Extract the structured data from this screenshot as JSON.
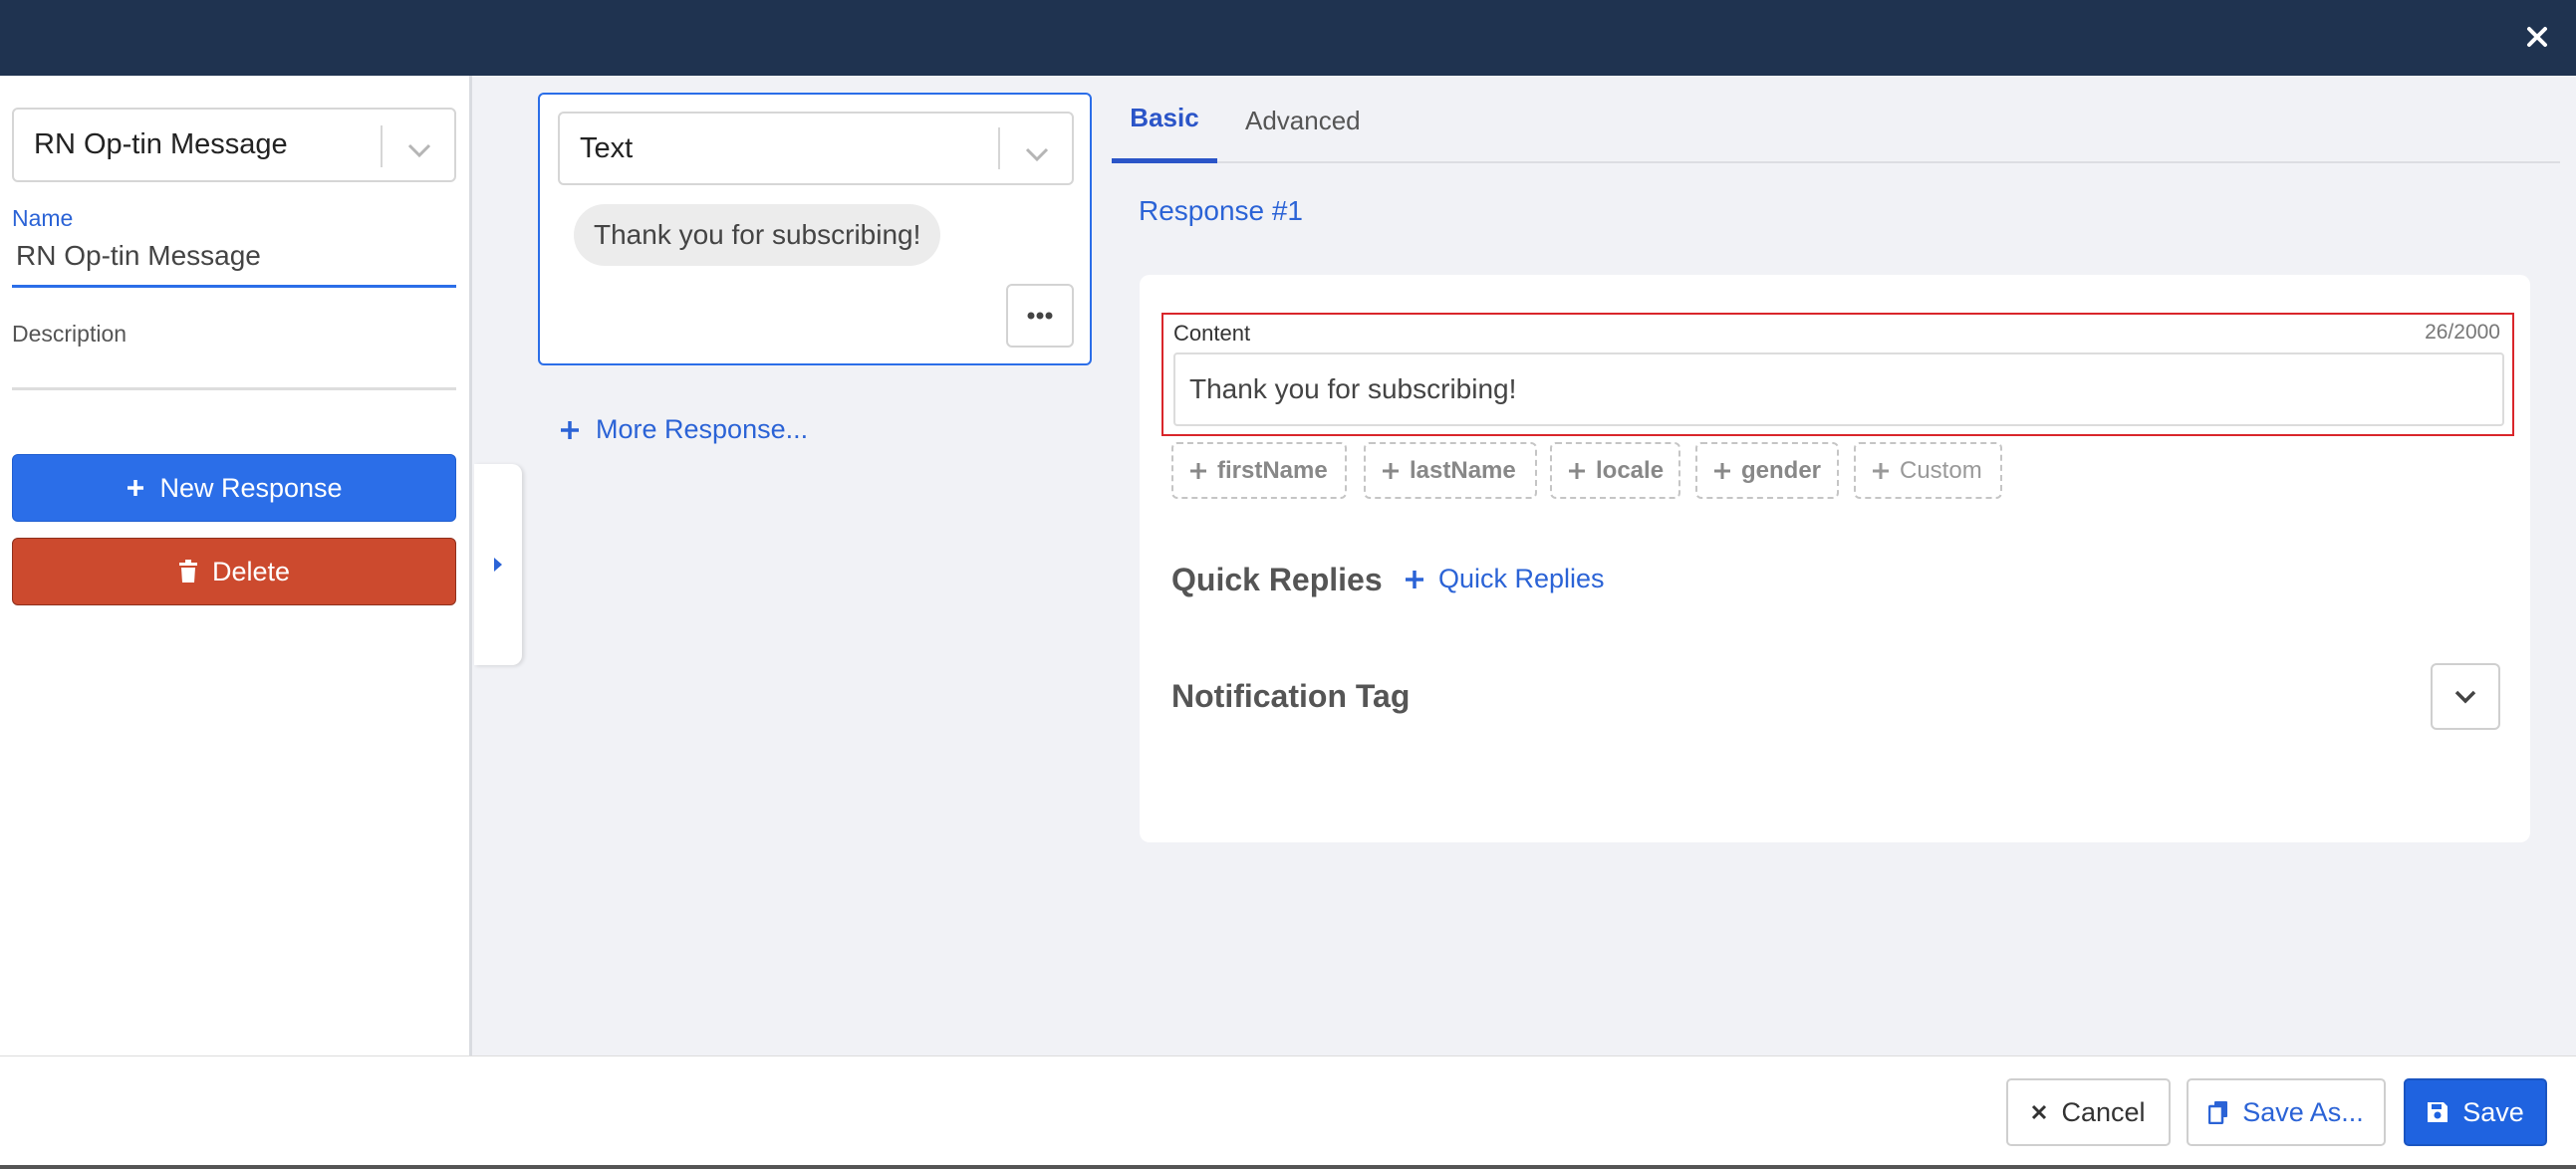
{
  "left_panel": {
    "selected_message": "RN Op-tin Message",
    "name_label": "Name",
    "name_value": "RN Op-tin Message",
    "description_label": "Description",
    "description_value": "",
    "new_response_label": "New Response",
    "delete_label": "Delete"
  },
  "response_card": {
    "type": "Text",
    "preview_text": "Thank you for subscribing!",
    "more_response_label": "More Response..."
  },
  "tabs": [
    {
      "label": "Basic",
      "active": true
    },
    {
      "label": "Advanced",
      "active": false
    }
  ],
  "editor": {
    "response_title": "Response #1",
    "content_label": "Content",
    "content_count": "26/2000",
    "content_value": "Thank you for subscribing!",
    "chips": [
      "firstName",
      "lastName",
      "locale",
      "gender",
      "Custom"
    ],
    "quick_replies_title": "Quick Replies",
    "quick_replies_add": "Quick Replies",
    "notification_tag_title": "Notification Tag"
  },
  "footer": {
    "cancel_label": "Cancel",
    "save_as_label": "Save As...",
    "save_label": "Save"
  },
  "colors": {
    "header": "#1f3350",
    "primary": "#2b6ee8",
    "danger": "#cc4a2e",
    "link": "#2b63d6",
    "error_outline": "#d9262b"
  }
}
